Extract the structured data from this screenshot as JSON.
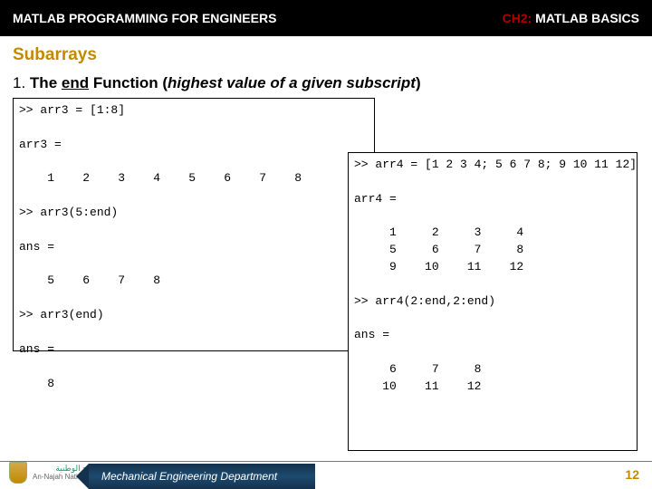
{
  "header": {
    "left": "MATLAB PROGRAMMING FOR ENGINEERS",
    "chapter_tag": "CH2:",
    "chapter_name": "MATLAB BASICS"
  },
  "section": {
    "title": "Subarrays"
  },
  "item": {
    "number": "1.",
    "pre": "The ",
    "fn": "end",
    "mid": " Function (",
    "paren": "highest value of a given subscript",
    "close": ")"
  },
  "code": {
    "a": ">> arr3 = [1:8]\n\narr3 =\n\n    1    2    3    4    5    6    7    8\n\n>> arr3(5:end)\n\nans =\n\n    5    6    7    8\n\n>> arr3(end)\n\nans =\n\n    8",
    "b": ">> arr4 = [1 2 3 4; 5 6 7 8; 9 10 11 12]\n\narr4 =\n\n     1     2     3     4\n     5     6     7     8\n     9    10    11    12\n\n>> arr4(2:end,2:end)\n\nans =\n\n     6     7     8\n    10    11    12"
  },
  "footer": {
    "uni_ar": "جامعة النجاح الوطنية",
    "uni_en": "An-Najah National University",
    "dept": "Mechanical Engineering Department",
    "page": "12"
  }
}
